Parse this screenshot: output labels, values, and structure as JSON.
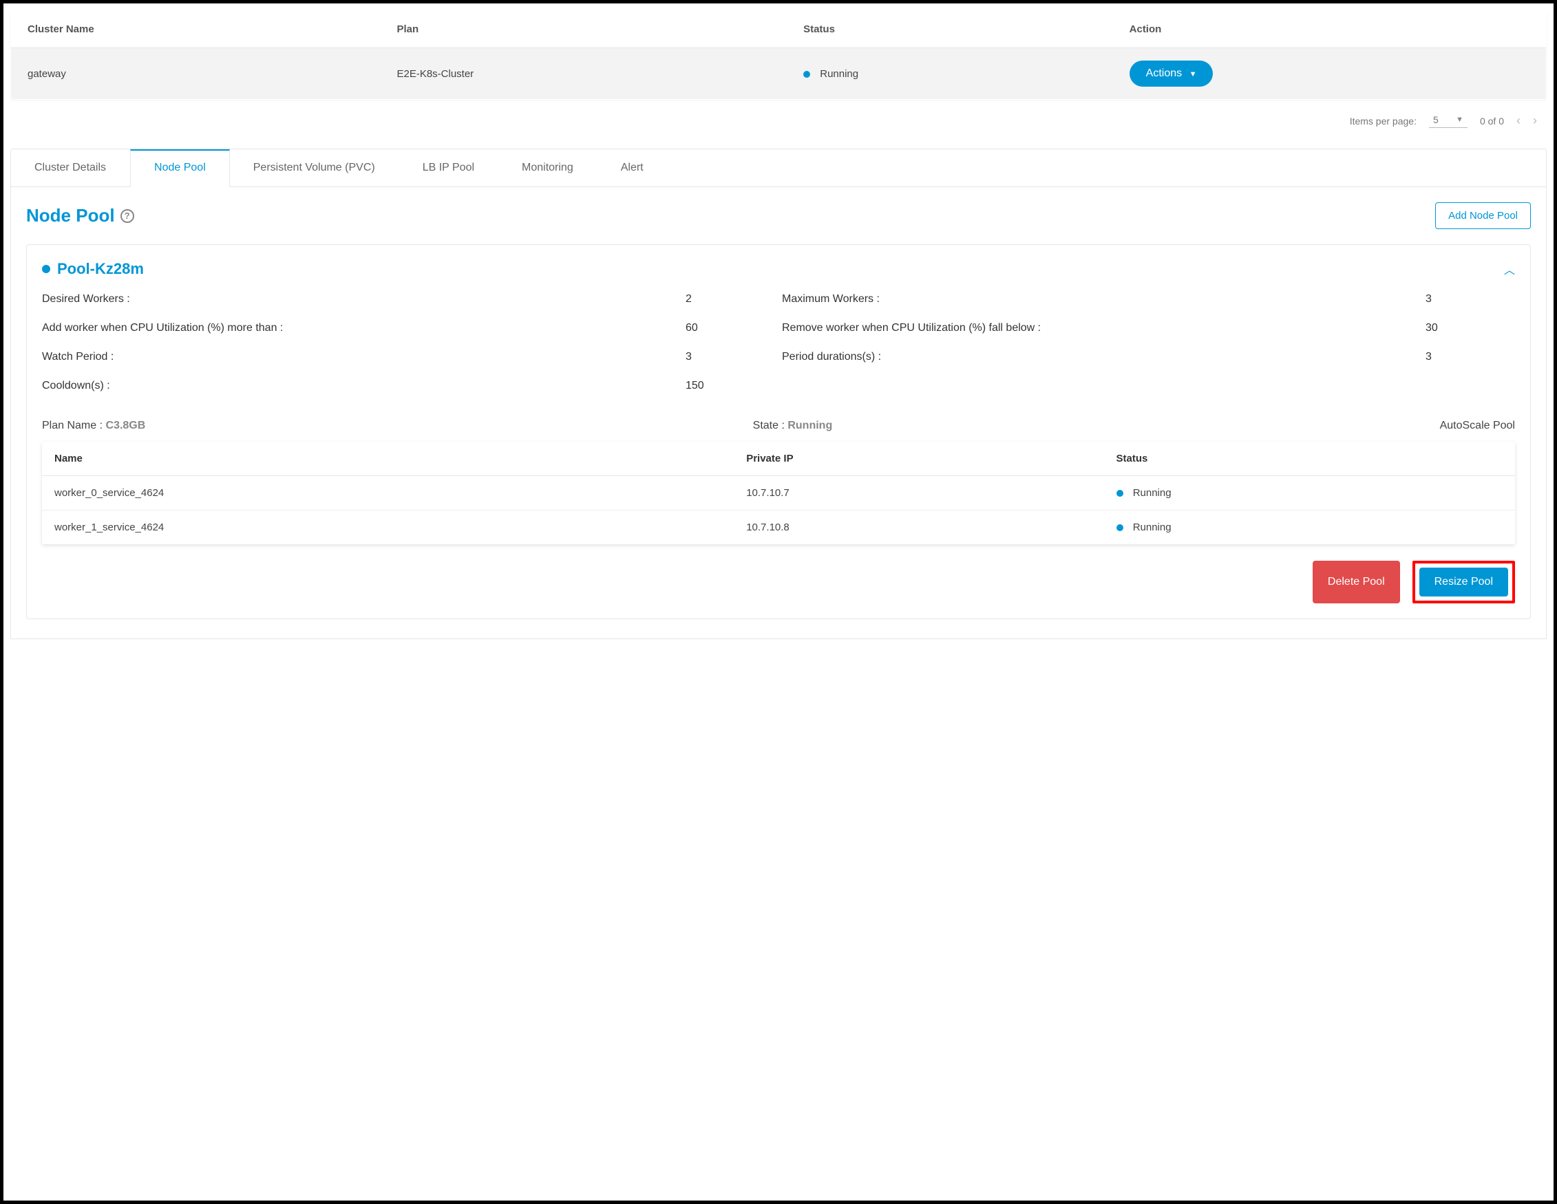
{
  "cluster_table": {
    "headers": {
      "name": "Cluster Name",
      "plan": "Plan",
      "status": "Status",
      "action": "Action"
    },
    "row": {
      "name": "gateway",
      "plan": "E2E-K8s-Cluster",
      "status": "Running",
      "action_label": "Actions"
    }
  },
  "pagination": {
    "items_label": "Items per page:",
    "items_value": "5",
    "range": "0 of 0"
  },
  "tabs": {
    "details": "Cluster Details",
    "node_pool": "Node Pool",
    "pvc": "Persistent Volume (PVC)",
    "lb": "LB IP Pool",
    "monitoring": "Monitoring",
    "alert": "Alert"
  },
  "section": {
    "title": "Node Pool",
    "add_label": "Add Node Pool"
  },
  "pool": {
    "name": "Pool-Kz28m",
    "kv": {
      "desired_label": "Desired Workers :",
      "desired_value": "2",
      "max_label": "Maximum Workers :",
      "max_value": "3",
      "add_cpu_label": "Add worker when CPU Utilization (%) more than :",
      "add_cpu_value": "60",
      "remove_cpu_label": "Remove worker when CPU Utilization (%) fall below :",
      "remove_cpu_value": "30",
      "watch_label": "Watch Period :",
      "watch_value": "3",
      "period_label": "Period durations(s) :",
      "period_value": "3",
      "cooldown_label": "Cooldown(s) :",
      "cooldown_value": "150"
    },
    "meta": {
      "plan_label": "Plan Name : ",
      "plan_value": "C3.8GB",
      "state_label": "State : ",
      "state_value": "Running",
      "autoscale": "AutoScale Pool"
    },
    "workers_headers": {
      "name": "Name",
      "ip": "Private IP",
      "status": "Status"
    },
    "workers": [
      {
        "name": "worker_0_service_4624",
        "ip": "10.7.10.7",
        "status": "Running"
      },
      {
        "name": "worker_1_service_4624",
        "ip": "10.7.10.8",
        "status": "Running"
      }
    ],
    "delete_label": "Delete Pool",
    "resize_label": "Resize Pool"
  }
}
